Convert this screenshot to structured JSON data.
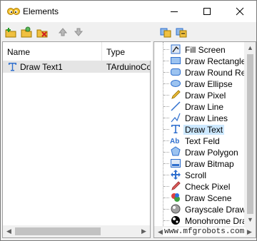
{
  "window": {
    "title": "Elements"
  },
  "columns": {
    "name": "Name",
    "type": "Type"
  },
  "elements": [
    {
      "name": "Draw Text1",
      "type": "TArduinoColo"
    }
  ],
  "tree": [
    {
      "label": "Fill Screen",
      "icon": "fill-screen-icon"
    },
    {
      "label": "Draw Rectangle",
      "icon": "rectangle-icon"
    },
    {
      "label": "Draw Round Recta",
      "icon": "round-rectangle-icon"
    },
    {
      "label": "Draw Ellipse",
      "icon": "ellipse-icon"
    },
    {
      "label": "Draw Pixel",
      "icon": "pencil-icon"
    },
    {
      "label": "Draw Line",
      "icon": "line-icon"
    },
    {
      "label": "Draw Lines",
      "icon": "lines-icon"
    },
    {
      "label": "Draw Text",
      "icon": "text-icon",
      "selected": true
    },
    {
      "label": "Text Feld",
      "icon": "text-field-icon"
    },
    {
      "label": "Draw Polygon",
      "icon": "polygon-icon"
    },
    {
      "label": "Draw Bitmap",
      "icon": "bitmap-icon"
    },
    {
      "label": "Scroll",
      "icon": "scroll-icon"
    },
    {
      "label": "Check Pixel",
      "icon": "check-pixel-icon"
    },
    {
      "label": "Draw Scene",
      "icon": "scene-icon"
    },
    {
      "label": "Grayscale Draw S",
      "icon": "grayscale-icon"
    },
    {
      "label": "Monohrome Draw",
      "icon": "monochrome-icon"
    }
  ],
  "watermark": "www.mfgrobots.com",
  "colors": {
    "selection": "#cce8ff",
    "row_highlight": "#e5e5e5",
    "accent": "#2f6fce"
  }
}
